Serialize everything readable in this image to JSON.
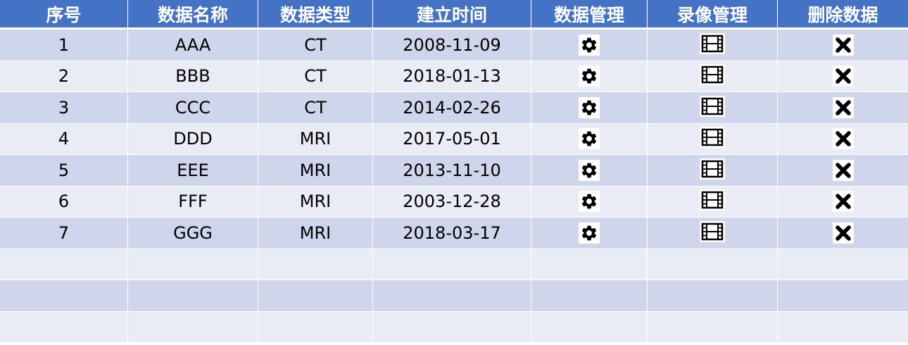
{
  "table": {
    "headers": [
      "序号",
      "数据名称",
      "数据类型",
      "建立时间",
      "数据管理",
      "录像管理",
      "删除数据"
    ],
    "rows": [
      {
        "index": "1",
        "name": "AAA",
        "type": "CT",
        "date": "2008-11-09"
      },
      {
        "index": "2",
        "name": "BBB",
        "type": "CT",
        "date": "2018-01-13"
      },
      {
        "index": "3",
        "name": "CCC",
        "type": "CT",
        "date": "2014-02-26"
      },
      {
        "index": "4",
        "name": "DDD",
        "type": "MRI",
        "date": "2017-05-01"
      },
      {
        "index": "5",
        "name": "EEE",
        "type": "MRI",
        "date": "2013-11-10"
      },
      {
        "index": "6",
        "name": "FFF",
        "type": "MRI",
        "date": "2003-12-28"
      },
      {
        "index": "7",
        "name": "GGG",
        "type": "MRI",
        "date": "2018-03-17"
      }
    ],
    "empty_rows": 3,
    "icons": {
      "data_manage": "gear-icon",
      "video_manage": "film-icon",
      "delete": "close-icon"
    }
  },
  "colors": {
    "header_bg": "#4472c4",
    "row_odd": "#cfd5ea",
    "row_even": "#e9ebf5",
    "header_text": "#ffffff"
  }
}
